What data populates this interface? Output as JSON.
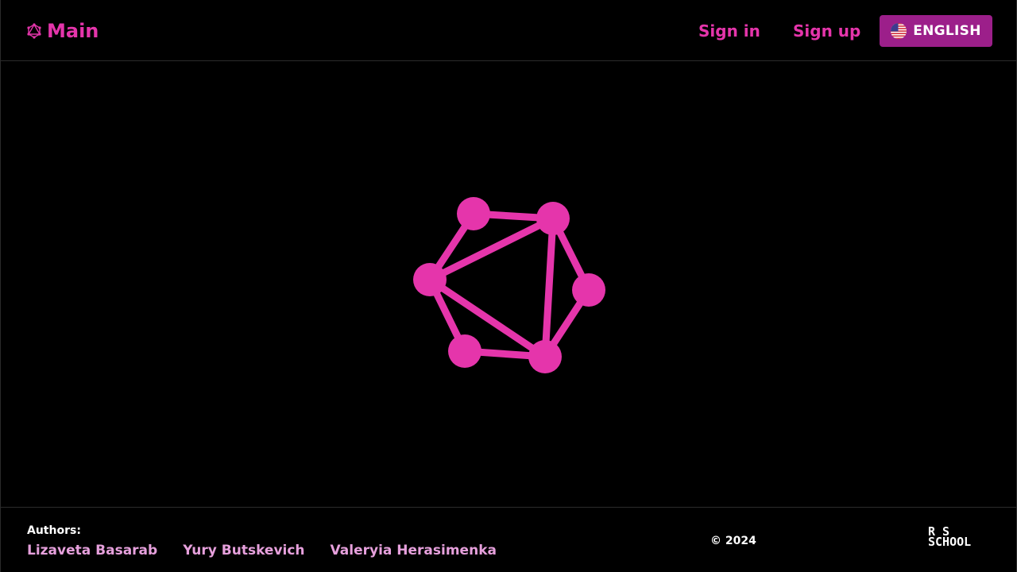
{
  "header": {
    "brand_label": "Main",
    "brand_icon": "graphql-icon",
    "signin_label": "Sign in",
    "signup_label": "Sign up",
    "language_label": "ENGLISH",
    "language_icon": "us-flag-icon"
  },
  "main": {
    "logo_icon": "graphql-logo-icon"
  },
  "footer": {
    "authors_title": "Authors:",
    "authors": [
      "Lizaveta Basarab",
      "Yury Butskevich",
      "Valeryia Herasimenka"
    ],
    "copyright": "© 2024",
    "school_logo": {
      "line1": "R S",
      "line2": "SCHOOL"
    }
  },
  "colors": {
    "accent": "#e535ab",
    "language_button": "#9c1f8a",
    "author_text": "#e6a0dc",
    "background": "#000000"
  }
}
